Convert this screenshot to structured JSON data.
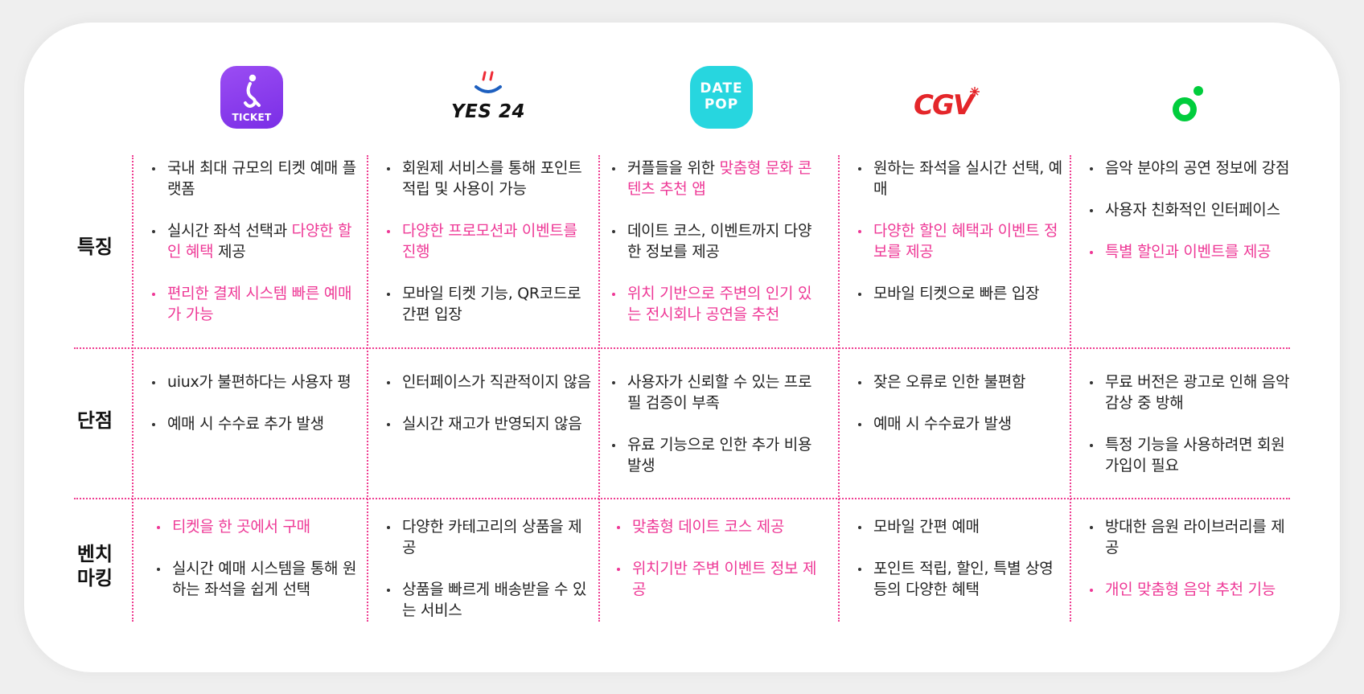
{
  "colors": {
    "accent": "#ee3896",
    "ticket": "#8a3cf0",
    "datepop": "#27d6df",
    "cgv": "#e4262a",
    "melon": "#00cd3c"
  },
  "logos": {
    "ticket": {
      "text": "TICKET",
      "icon": "ticket-person-icon"
    },
    "yes24": {
      "text": "YES 24",
      "icon": "smile-icon"
    },
    "datepop": {
      "line1": "DATE",
      "line2": "POP"
    },
    "cgv": {
      "text": "CGV"
    },
    "melon": {
      "icon": "melon-icon"
    }
  },
  "rows": {
    "features": "특징",
    "cons": "단점",
    "bench_line1": "벤치",
    "bench_line2": "마킹"
  },
  "columns": [
    {
      "features": [
        {
          "text": "국내 최대 규모의 티켓 예매 플랫폼"
        },
        {
          "pre": "실시간 좌석 선택과 ",
          "pink": "다양한 할인 혜택",
          "post": " 제공"
        },
        {
          "pink": "편리한 결제 시스템 빠른 예매가",
          "post": " 가능"
        }
      ],
      "cons": [
        "uiux가 불편하다는 사용자 평",
        "예매 시 수수료 추가 발생"
      ],
      "bench": [
        {
          "text": "티켓을 한 곳에서 구매",
          "highlight": true
        },
        {
          "text": "실시간 예매 시스템을 통해 원하는 좌석을 쉽게 선택",
          "highlight": false
        }
      ]
    },
    {
      "features": [
        {
          "text": "회원제 서비스를 통해 포인트 적립 및 사용이 가능"
        },
        {
          "pink": "다양한 프로모션과 이벤트",
          "post": "를 진행"
        },
        {
          "text": "모바일 티켓 기능, QR코드로 간편 입장"
        }
      ],
      "cons": [
        "인터페이스가 직관적이지 않음",
        "실시간 재고가 반영되지 않음"
      ],
      "bench": [
        {
          "text": "다양한 카테고리의 상품을 제공",
          "highlight": false
        },
        {
          "text": "상품을 빠르게 배송받을 수 있는 서비스",
          "highlight": false
        }
      ]
    },
    {
      "features": [
        {
          "pre": "커플들을 위한 ",
          "pink": "맞춤형 문화 콘텐츠 추천 앱"
        },
        {
          "text": "데이트 코스, 이벤트까지 다양한 정보를 제공"
        },
        {
          "pink": "위치 기반",
          "post": "으로 주변의 인기 있는 전시회나 공연을 추천"
        }
      ],
      "cons": [
        "사용자가 신뢰할 수 있는 프로필 검증이 부족",
        "유료 기능으로 인한 추가 비용 발생"
      ],
      "bench": [
        {
          "text": "맞춤형 데이트 코스 제공",
          "highlight": true
        },
        {
          "text": "위치기반 주변 이벤트 정보 제공",
          "highlight": true
        }
      ]
    },
    {
      "features": [
        {
          "text": "원하는 좌석을 실시간 선택, 예매"
        },
        {
          "pink": "다양한 할인 혜택과 이벤트 정보를 제공"
        },
        {
          "text": "모바일 티켓으로 빠른 입장"
        }
      ],
      "cons": [
        "잦은 오류로 인한 불편함",
        "예매 시 수수료가 발생"
      ],
      "bench": [
        {
          "text": "모바일 간편 예매",
          "highlight": false
        },
        {
          "text": "포인트 적립, 할인, 특별 상영 등의 다양한 혜택",
          "highlight": false
        }
      ]
    },
    {
      "features": [
        {
          "text": "음악 분야의 공연 정보에 강점"
        },
        {
          "text": "사용자 친화적인 인터페이스"
        },
        {
          "pink": "특별 할인과 이벤트를 제공"
        }
      ],
      "cons": [
        "무료 버전은 광고로 인해 음악 감상 중 방해",
        "특정 기능을 사용하려면 회원가입이 필요"
      ],
      "bench": [
        {
          "text": "방대한 음원 라이브러리를 제공",
          "highlight": false
        },
        {
          "text": "개인 맞춤형 음악 추천 기능",
          "highlight": true
        }
      ]
    }
  ]
}
